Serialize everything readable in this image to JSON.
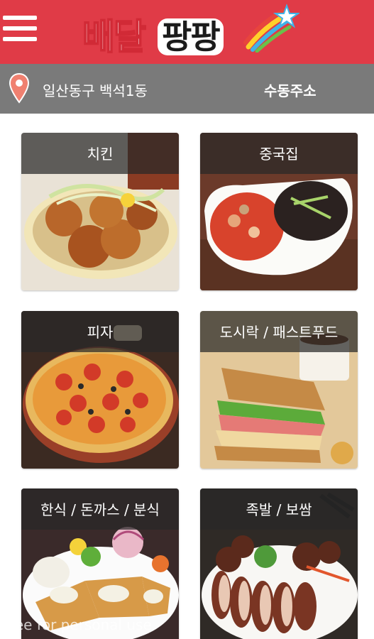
{
  "header": {
    "menu_icon": "hamburger-menu-icon",
    "logo": {
      "part1": "배달",
      "part2": "팡팡"
    },
    "background_color": "#e03b47"
  },
  "address_bar": {
    "location_icon": "map-pin-icon",
    "address": "일산동구 백석1동",
    "manual_button": "수동주소",
    "background_color": "#7a7a7a"
  },
  "categories": [
    {
      "label": "치킨",
      "image": "fried-chicken-image"
    },
    {
      "label": "중국집",
      "image": "jjajangmyeon-jjamppong-image"
    },
    {
      "label": "피자",
      "image": "pizza-image"
    },
    {
      "label": "도시락 / 패스트푸드",
      "image": "sandwich-image"
    },
    {
      "label": "한식 / 돈까스 / 분식",
      "image": "donkatsu-image"
    },
    {
      "label": "족발 / 보쌈",
      "image": "jokbal-image"
    }
  ],
  "watermark": "free for personal use"
}
